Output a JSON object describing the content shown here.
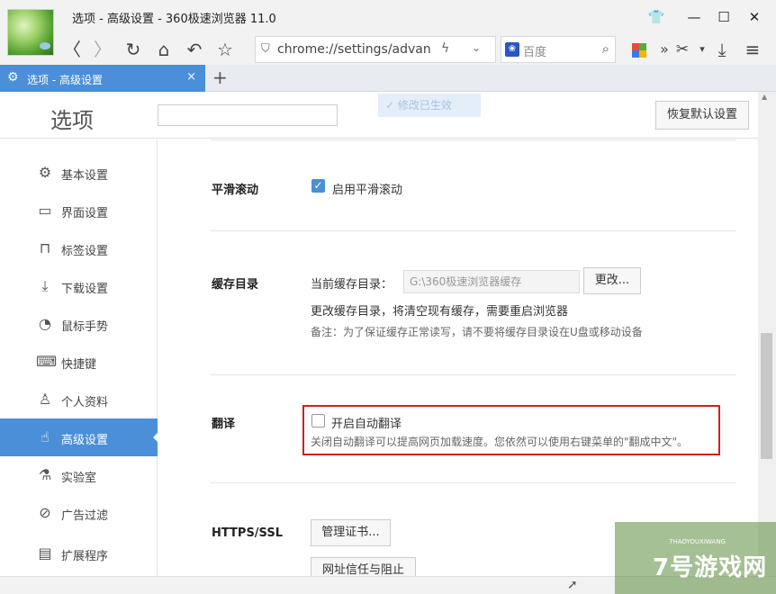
{
  "window": {
    "title": "选项 - 高级设置 - 360极速浏览器 11.0",
    "controls": {
      "skin": "👕",
      "minimize": "—",
      "maximize": "☐",
      "close": "✕"
    }
  },
  "toolbar": {
    "back": "〈",
    "forward": "〉",
    "reload": "↻",
    "home": "⌂",
    "undo": "↶",
    "star": "☆",
    "url": "chrome://settings/advanc",
    "search_engine": "百度",
    "more": "»",
    "scissors": "✂",
    "caret": "▾",
    "download": "⤓",
    "menu": "≡"
  },
  "tabs": [
    {
      "label": "选项 - 高级设置",
      "close": "×"
    }
  ],
  "new_tab": "+",
  "header": {
    "title": "选项",
    "toast": "✓ 修改已生效",
    "reset_button": "恢复默认设置"
  },
  "sidebar": {
    "items": [
      {
        "label": "基本设置",
        "icon": "gear-icon",
        "glyph": "⚙"
      },
      {
        "label": "界面设置",
        "icon": "window-icon",
        "glyph": "▭"
      },
      {
        "label": "标签设置",
        "icon": "tab-icon",
        "glyph": "⊓"
      },
      {
        "label": "下载设置",
        "icon": "download-icon",
        "glyph": "⤓"
      },
      {
        "label": "鼠标手势",
        "icon": "mouse-icon",
        "glyph": "◔"
      },
      {
        "label": "快捷键",
        "icon": "keyboard-icon",
        "glyph": "⌨"
      },
      {
        "label": "个人资料",
        "icon": "person-icon",
        "glyph": "♙"
      },
      {
        "label": "高级设置",
        "icon": "hand-icon",
        "glyph": "☝",
        "active": true
      },
      {
        "label": "实验室",
        "icon": "flask-icon",
        "glyph": "⚗"
      },
      {
        "label": "广告过滤",
        "icon": "block-icon",
        "glyph": "⊘"
      },
      {
        "label": "扩展程序",
        "icon": "extension-icon",
        "glyph": "▤"
      }
    ]
  },
  "smooth_scroll": {
    "title": "平滑滚动",
    "checkbox_label": "启用平滑滚动",
    "checked": true
  },
  "cache": {
    "title": "缓存目录",
    "current_label": "当前缓存目录：",
    "path": "G:\\360极速浏览器缓存",
    "change_button": "更改...",
    "note1": "更改缓存目录，将清空现有缓存，需要重启浏览器",
    "note2": "备注：为了保证缓存正常读写，请不要将缓存目录设在U盘或移动设备"
  },
  "translate": {
    "title": "翻译",
    "checkbox_label": "开启自动翻译",
    "checked": false,
    "description": "关闭自动翻译可以提高网页加载速度。您依然可以使用右键菜单的\"翻成中文\"。"
  },
  "https": {
    "title": "HTTPS/SSL",
    "manage_cert_button": "管理证书...",
    "site_trust_button": "网址信任与阻止"
  },
  "watermark": {
    "text": "7号游戏网",
    "sub": "7HAOYOUXIWANG"
  },
  "colors": {
    "accent": "#4a8fd8",
    "highlight_border": "#cc2222"
  }
}
